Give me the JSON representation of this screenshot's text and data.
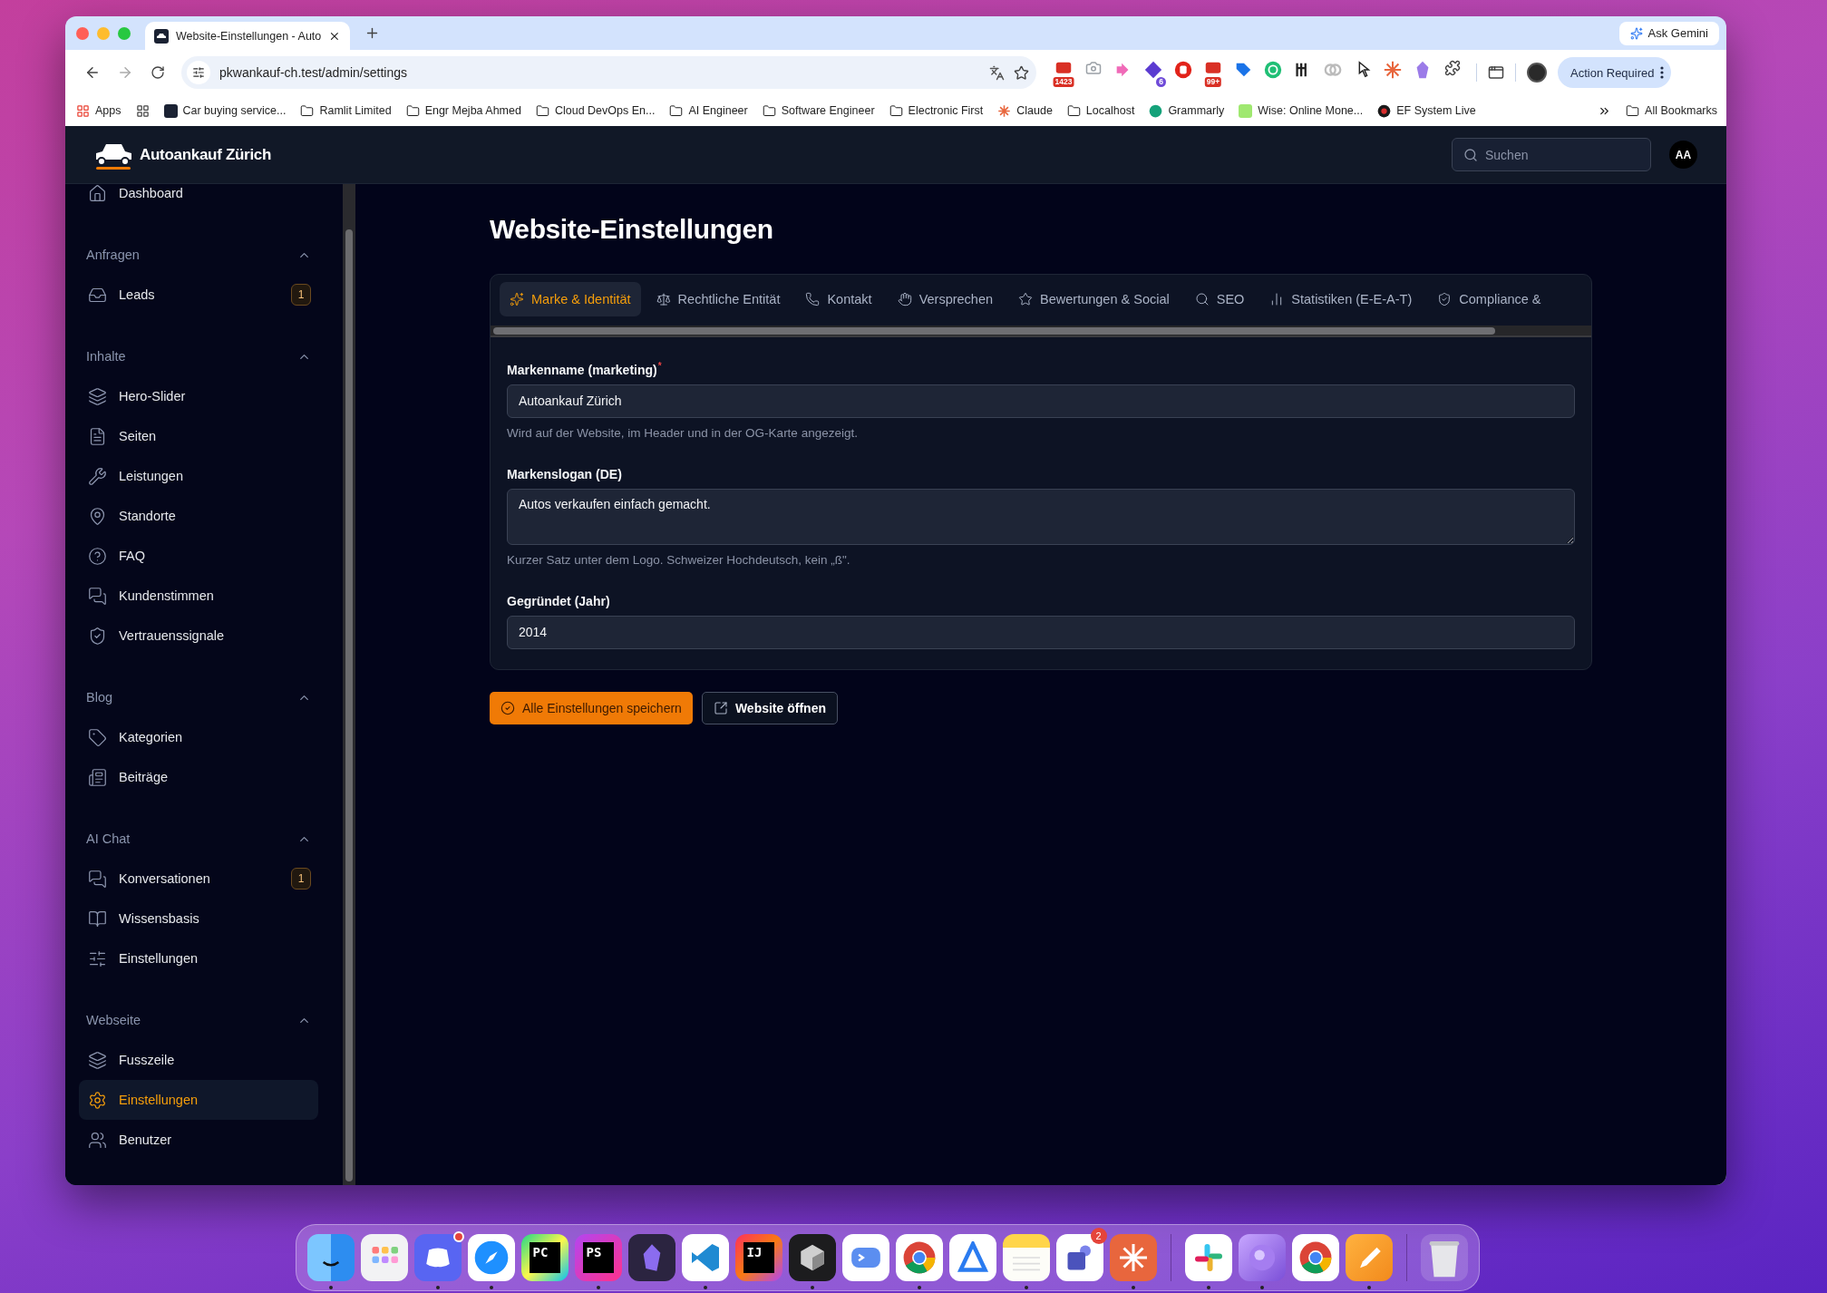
{
  "browser": {
    "tab_title": "Website-Einstellungen - Auto",
    "url": "pkwankauf-ch.test/admin/settings",
    "ask_gemini": "Ask Gemini",
    "action_required": "Action Required",
    "extensions": [
      {
        "kind": "mail",
        "badge": "1423"
      },
      {
        "kind": "camera"
      },
      {
        "kind": "flow"
      },
      {
        "kind": "diamond",
        "badge": "6"
      },
      {
        "kind": "stop"
      },
      {
        "kind": "mail",
        "badge": "99+"
      },
      {
        "kind": "tag"
      },
      {
        "kind": "sync"
      },
      {
        "kind": "fork"
      },
      {
        "kind": "link"
      },
      {
        "kind": "pointer"
      },
      {
        "kind": "burst"
      },
      {
        "kind": "crystal"
      },
      {
        "kind": "puzzle"
      }
    ],
    "bookmarks": [
      {
        "kind": "apps",
        "label": "Apps"
      },
      {
        "kind": "grid"
      },
      {
        "kind": "site",
        "label": "Car buying service..."
      },
      {
        "kind": "folder",
        "label": "Ramlit Limited"
      },
      {
        "kind": "folder",
        "label": "Engr Mejba Ahmed"
      },
      {
        "kind": "folder",
        "label": "Cloud DevOps En..."
      },
      {
        "kind": "folder",
        "label": "AI Engineer"
      },
      {
        "kind": "folder",
        "label": "Software Engineer"
      },
      {
        "kind": "folder",
        "label": "Electronic First"
      },
      {
        "kind": "burst",
        "label": "Claude"
      },
      {
        "kind": "folder",
        "label": "Localhost"
      },
      {
        "kind": "grammar",
        "label": "Grammarly"
      },
      {
        "kind": "wise",
        "label": "Wise: Online Mone..."
      },
      {
        "kind": "ef",
        "label": "EF System Live"
      }
    ],
    "all_bookmarks": "All Bookmarks"
  },
  "app": {
    "brand": "Autoankauf Zürich",
    "search_placeholder": "Suchen",
    "avatar": "AA"
  },
  "sidebar": {
    "top_item": {
      "label": "Dashboard",
      "kind": "home"
    },
    "groups": [
      {
        "label": "Anfragen",
        "expanded": true,
        "items": [
          {
            "label": "Leads",
            "kind": "inbox",
            "badge": "1",
            "selected": false
          }
        ]
      },
      {
        "label": "Inhalte",
        "expanded": true,
        "items": [
          {
            "label": "Hero-Slider",
            "kind": "stack",
            "selected": false
          },
          {
            "label": "Seiten",
            "kind": "file",
            "selected": false
          },
          {
            "label": "Leistungen",
            "kind": "tools",
            "selected": false
          },
          {
            "label": "Standorte",
            "kind": "pin",
            "selected": false
          },
          {
            "label": "FAQ",
            "kind": "help",
            "selected": false
          },
          {
            "label": "Kundenstimmen",
            "kind": "chat",
            "selected": false
          },
          {
            "label": "Vertrauenssignale",
            "kind": "shield",
            "selected": false
          }
        ]
      },
      {
        "label": "Blog",
        "expanded": true,
        "items": [
          {
            "label": "Kategorien",
            "kind": "tag",
            "selected": false
          },
          {
            "label": "Beiträge",
            "kind": "news",
            "selected": false
          }
        ]
      },
      {
        "label": "AI Chat",
        "expanded": true,
        "items": [
          {
            "label": "Konversationen",
            "kind": "chat",
            "badge": "1",
            "selected": false
          },
          {
            "label": "Wissensbasis",
            "kind": "book",
            "selected": false
          },
          {
            "label": "Einstellungen",
            "kind": "sliders",
            "selected": false
          }
        ]
      },
      {
        "label": "Webseite",
        "expanded": true,
        "items": [
          {
            "label": "Fusszeile",
            "kind": "stack",
            "selected": false
          },
          {
            "label": "Einstellungen",
            "kind": "gear",
            "selected": true
          },
          {
            "label": "Benutzer",
            "kind": "users",
            "selected": false
          }
        ]
      }
    ]
  },
  "page": {
    "title": "Website-Einstellungen",
    "tabs": [
      {
        "label": "Marke & Identität",
        "kind": "sparkles",
        "selected": true
      },
      {
        "label": "Rechtliche Entität",
        "kind": "scale",
        "selected": false
      },
      {
        "label": "Kontakt",
        "kind": "phone",
        "selected": false
      },
      {
        "label": "Versprechen",
        "kind": "hand",
        "selected": false
      },
      {
        "label": "Bewertungen & Social",
        "kind": "star",
        "selected": false
      },
      {
        "label": "SEO",
        "kind": "search",
        "selected": false
      },
      {
        "label": "Statistiken (E-E-A-T)",
        "kind": "chart",
        "selected": false
      },
      {
        "label": "Compliance &",
        "kind": "shield",
        "selected": false
      }
    ],
    "fields": [
      {
        "kind": "input",
        "label": "Markenname (marketing)",
        "required_mark": "*",
        "value": "Autoankauf Zürich",
        "hint": "Wird auf der Website, im Header und in der OG-Karte angezeigt."
      },
      {
        "kind": "textarea",
        "label": "Markenslogan (DE)",
        "value": "Autos verkaufen einfach gemacht.",
        "hint": "Kurzer Satz unter dem Logo. Schweizer Hochdeutsch, kein „ß\"."
      },
      {
        "kind": "input",
        "label": "Gegründet (Jahr)",
        "value": "2014"
      }
    ],
    "save_button": "Alle Einstellungen speichern",
    "open_button": "Website öffnen"
  },
  "dock": [
    {
      "kind": "finder",
      "running": true
    },
    {
      "kind": "launchpad",
      "running": false
    },
    {
      "kind": "discord",
      "running": true,
      "dot_badge": true
    },
    {
      "kind": "safari",
      "running": true
    },
    {
      "kind": "pycharm",
      "glyph": "PC",
      "running": false
    },
    {
      "kind": "phpstorm",
      "glyph": "PS",
      "running": true
    },
    {
      "kind": "obsidian",
      "running": false
    },
    {
      "kind": "vscode",
      "running": true
    },
    {
      "kind": "intellij",
      "glyph": "IJ",
      "running": false
    },
    {
      "kind": "cube",
      "running": true
    },
    {
      "kind": "terminal",
      "running": false
    },
    {
      "kind": "chrome",
      "running": true
    },
    {
      "kind": "xcode",
      "running": false
    },
    {
      "kind": "notes",
      "running": true
    },
    {
      "kind": "teams",
      "badge": "2",
      "running": false
    },
    {
      "kind": "claude",
      "running": true
    },
    {
      "kind": "separator"
    },
    {
      "kind": "slack",
      "running": true
    },
    {
      "kind": "orb",
      "running": true
    },
    {
      "kind": "chrome",
      "running": false
    },
    {
      "kind": "pages",
      "running": true
    },
    {
      "kind": "separator"
    },
    {
      "kind": "trash",
      "running": false
    }
  ]
}
